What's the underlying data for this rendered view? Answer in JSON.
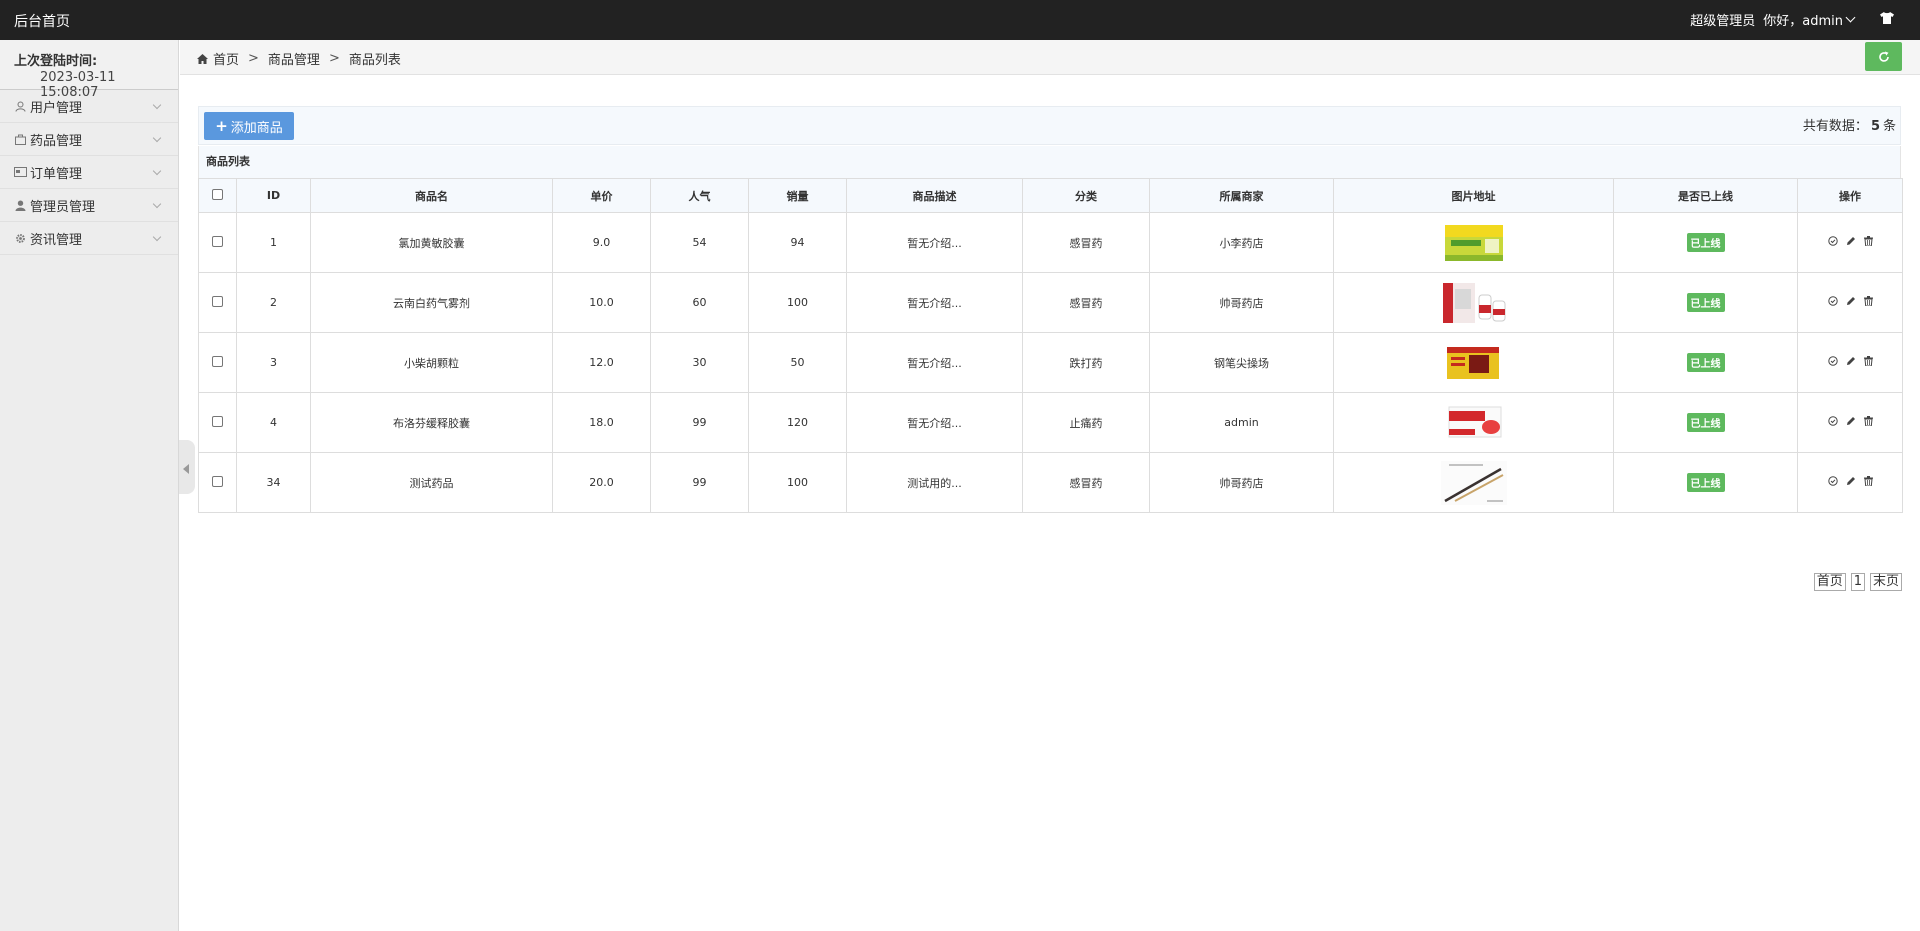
{
  "topbar": {
    "brand": "后台首页",
    "role": "超级管理员",
    "greeting": "你好，admin"
  },
  "sidebar": {
    "login_label": "上次登陆时间:",
    "login_time": "2023-03-11 15:08:07",
    "items": [
      {
        "label": "用户管理",
        "icon": "user-icon"
      },
      {
        "label": "药品管理",
        "icon": "bag-icon"
      },
      {
        "label": "订单管理",
        "icon": "card-icon"
      },
      {
        "label": "管理员管理",
        "icon": "person-icon"
      },
      {
        "label": "资讯管理",
        "icon": "gear-icon"
      }
    ]
  },
  "breadcrumb": {
    "home": "首页",
    "level1": "商品管理",
    "level2": "商品列表"
  },
  "toolbar": {
    "add_label": "添加商品",
    "total_prefix": "共有数据：",
    "total_count": "5",
    "total_suffix": "条"
  },
  "table": {
    "title": "商品列表",
    "columns": [
      "ID",
      "商品名",
      "单价",
      "人气",
      "销量",
      "商品描述",
      "分类",
      "所属商家",
      "图片地址",
      "是否已上线",
      "操作"
    ],
    "rows": [
      {
        "id": "1",
        "name": "氯加黄敏胶囊",
        "price": "9.0",
        "popularity": "54",
        "sales": "94",
        "desc": "暂无介绍...",
        "category": "感冒药",
        "merchant": "小李药店",
        "status": "已上线",
        "img": "box-yellow-green"
      },
      {
        "id": "2",
        "name": "云南白药气雾剂",
        "price": "10.0",
        "popularity": "60",
        "sales": "100",
        "desc": "暂无介绍...",
        "category": "感冒药",
        "merchant": "帅哥药店",
        "status": "已上线",
        "img": "box-red-white"
      },
      {
        "id": "3",
        "name": "小柴胡颗粒",
        "price": "12.0",
        "popularity": "30",
        "sales": "50",
        "desc": "暂无介绍...",
        "category": "跌打药",
        "merchant": "钢笔尖操场",
        "status": "已上线",
        "img": "box-yellow-red"
      },
      {
        "id": "4",
        "name": "布洛芬缓释胶囊",
        "price": "18.0",
        "popularity": "99",
        "sales": "120",
        "desc": "暂无介绍...",
        "category": "止痛药",
        "merchant": "admin",
        "status": "已上线",
        "img": "box-white-red"
      },
      {
        "id": "34",
        "name": "测试药品",
        "price": "20.0",
        "popularity": "99",
        "sales": "100",
        "desc": "测试用的...",
        "category": "感冒药",
        "merchant": "帅哥药店",
        "status": "已上线",
        "img": "chopsticks"
      }
    ]
  },
  "pager": {
    "first": "首页",
    "current": "1",
    "last": "末页"
  },
  "colors": {
    "topbar": "#222222",
    "accent_blue": "#5a98de",
    "accent_green": "#5eb95e"
  }
}
